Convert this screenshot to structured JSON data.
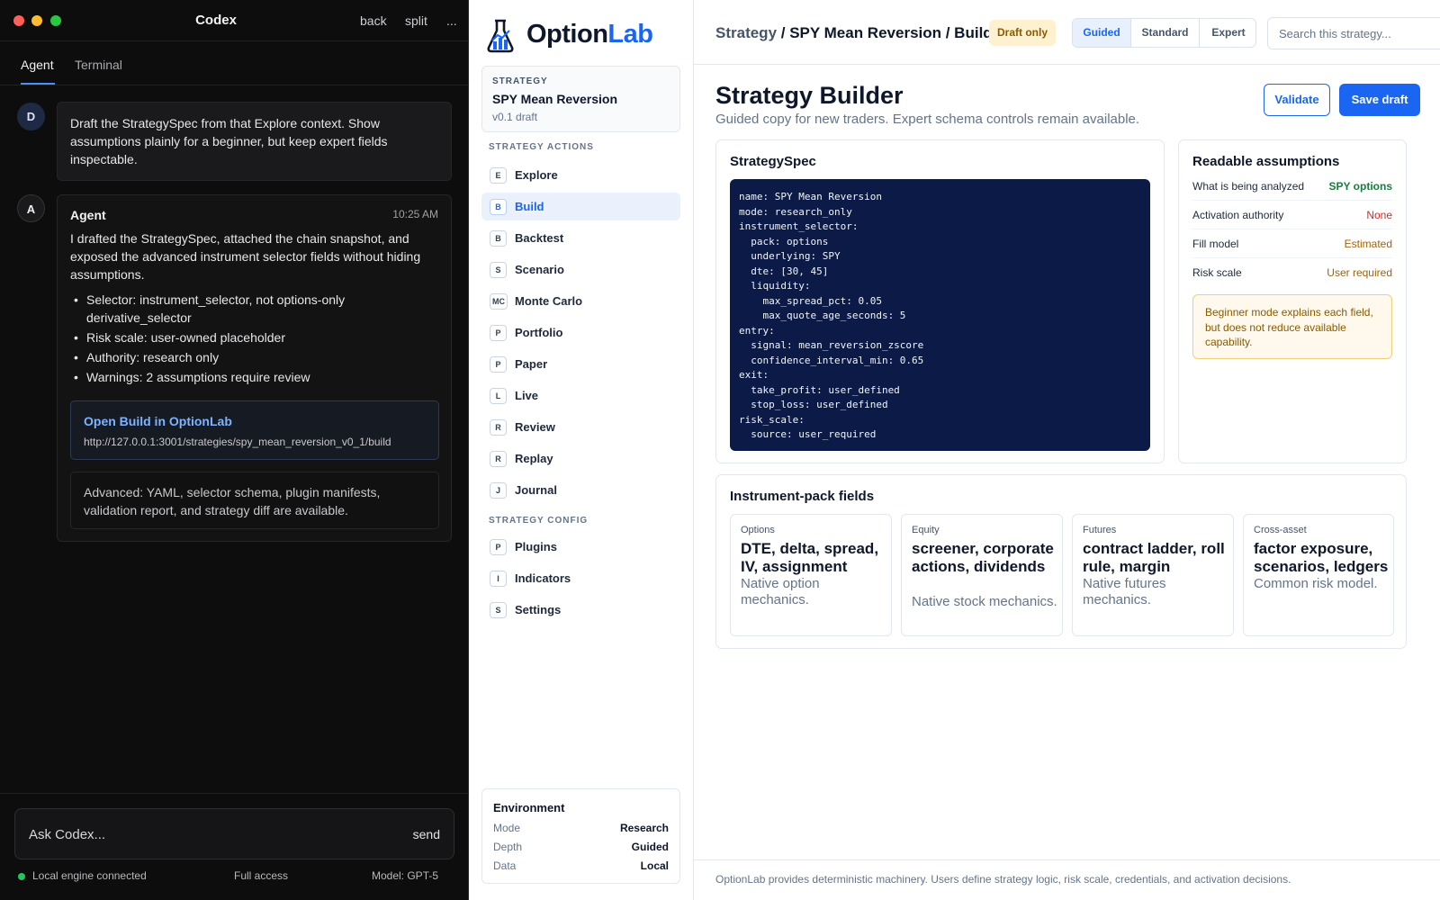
{
  "codex": {
    "title": "Codex",
    "nav": {
      "back": "back",
      "split": "split",
      "more": "..."
    },
    "tabs": {
      "agent": "Agent",
      "terminal": "Terminal"
    },
    "user_avatar": "D",
    "user_message": "Draft the StrategySpec from that Explore context. Show assumptions plainly for a beginner, but keep expert fields inspectable.",
    "agent_avatar": "A",
    "agent_name": "Agent",
    "agent_time": "10:25 AM",
    "agent_intro": "I drafted the StrategySpec, attached the chain snapshot, and exposed the advanced instrument selector fields without hiding assumptions.",
    "agent_bullets": [
      "Selector: instrument_selector, not options-only derivative_selector",
      "Risk scale: user-owned placeholder",
      "Authority: research only",
      "Warnings: 2 assumptions require review"
    ],
    "link_title": "Open Build in OptionLab",
    "link_url": "http://127.0.0.1:3001/strategies/spy_mean_reversion_v0_1/build",
    "advanced_note": "Advanced: YAML, selector schema, plugin manifests, validation report, and strategy diff are available.",
    "input_placeholder": "Ask Codex...",
    "send_label": "send",
    "status_connected": "Local engine connected",
    "status_access": "Full access",
    "status_model": "Model: GPT-5"
  },
  "sidebar": {
    "logo_part1": "Option",
    "logo_part2": "Lab",
    "strategy_label": "STRATEGY",
    "strategy_name": "SPY Mean Reversion",
    "strategy_version": "v0.1 draft",
    "actions_header": "STRATEGY ACTIONS",
    "actions": [
      {
        "badge": "E",
        "label": "Explore"
      },
      {
        "badge": "B",
        "label": "Build"
      },
      {
        "badge": "B",
        "label": "Backtest"
      },
      {
        "badge": "S",
        "label": "Scenario"
      },
      {
        "badge": "MC",
        "label": "Monte Carlo"
      },
      {
        "badge": "P",
        "label": "Portfolio"
      },
      {
        "badge": "P",
        "label": "Paper"
      },
      {
        "badge": "L",
        "label": "Live"
      },
      {
        "badge": "R",
        "label": "Review"
      },
      {
        "badge": "R",
        "label": "Replay"
      },
      {
        "badge": "J",
        "label": "Journal"
      }
    ],
    "config_header": "STRATEGY CONFIG",
    "config": [
      {
        "badge": "P",
        "label": "Plugins"
      },
      {
        "badge": "I",
        "label": "Indicators"
      },
      {
        "badge": "S",
        "label": "Settings"
      }
    ],
    "environment": {
      "title": "Environment",
      "rows": [
        {
          "key": "Mode",
          "value": "Research"
        },
        {
          "key": "Depth",
          "value": "Guided"
        },
        {
          "key": "Data",
          "value": "Local"
        }
      ]
    }
  },
  "main": {
    "breadcrumb_root": "Strategy",
    "breadcrumb_rest": " / SPY Mean Reversion / Build",
    "draft_badge": "Draft only",
    "modes": [
      "Guided",
      "Standard",
      "Expert"
    ],
    "search_placeholder": "Search this strategy...",
    "title": "Strategy Builder",
    "subtitle": "Guided copy for new traders. Expert schema controls remain available.",
    "validate_label": "Validate",
    "save_label": "Save draft",
    "spec_title": "StrategySpec",
    "spec_yaml": "name: SPY Mean Reversion\nmode: research_only\ninstrument_selector:\n  pack: options\n  underlying: SPY\n  dte: [30, 45]\n  liquidity:\n    max_spread_pct: 0.05\n    max_quote_age_seconds: 5\nentry:\n  signal: mean_reversion_zscore\n  confidence_interval_min: 0.65\nexit:\n  take_profit: user_defined\n  stop_loss: user_defined\nrisk_scale:\n  source: user_required",
    "assumptions_title": "Readable assumptions",
    "assumptions": [
      {
        "key": "What is being analyzed",
        "value": "SPY options",
        "color": "#15803d"
      },
      {
        "key": "Activation authority",
        "value": "None",
        "color": "#dc2626"
      },
      {
        "key": "Fill model",
        "value": "Estimated",
        "color": "#a16207"
      },
      {
        "key": "Risk scale",
        "value": "User required",
        "color": "#a16207"
      }
    ],
    "assumptions_note": "Beginner mode explains each field, but does not reduce available capability.",
    "fields_title": "Instrument-pack fields",
    "packs": [
      {
        "label": "Options",
        "title": "DTE, delta, spread, IV, assignment",
        "desc": "Native option mechanics."
      },
      {
        "label": "Equity",
        "title": "screener, corporate actions, dividends",
        "desc": "Native stock mechanics."
      },
      {
        "label": "Futures",
        "title": "contract ladder, roll rule, margin",
        "desc": "Native futures mechanics."
      },
      {
        "label": "Cross-asset",
        "title": "factor exposure, scenarios, ledgers",
        "desc": "Common risk model."
      }
    ],
    "footer": "OptionLab provides deterministic machinery. Users define strategy logic, risk scale, credentials, and activation decisions."
  },
  "colors": {
    "accent": "#1a66f2",
    "codex_bg": "#0d0d0e",
    "code_bg": "#0b1a47",
    "draft_badge_bg": "#fdf1cf"
  }
}
